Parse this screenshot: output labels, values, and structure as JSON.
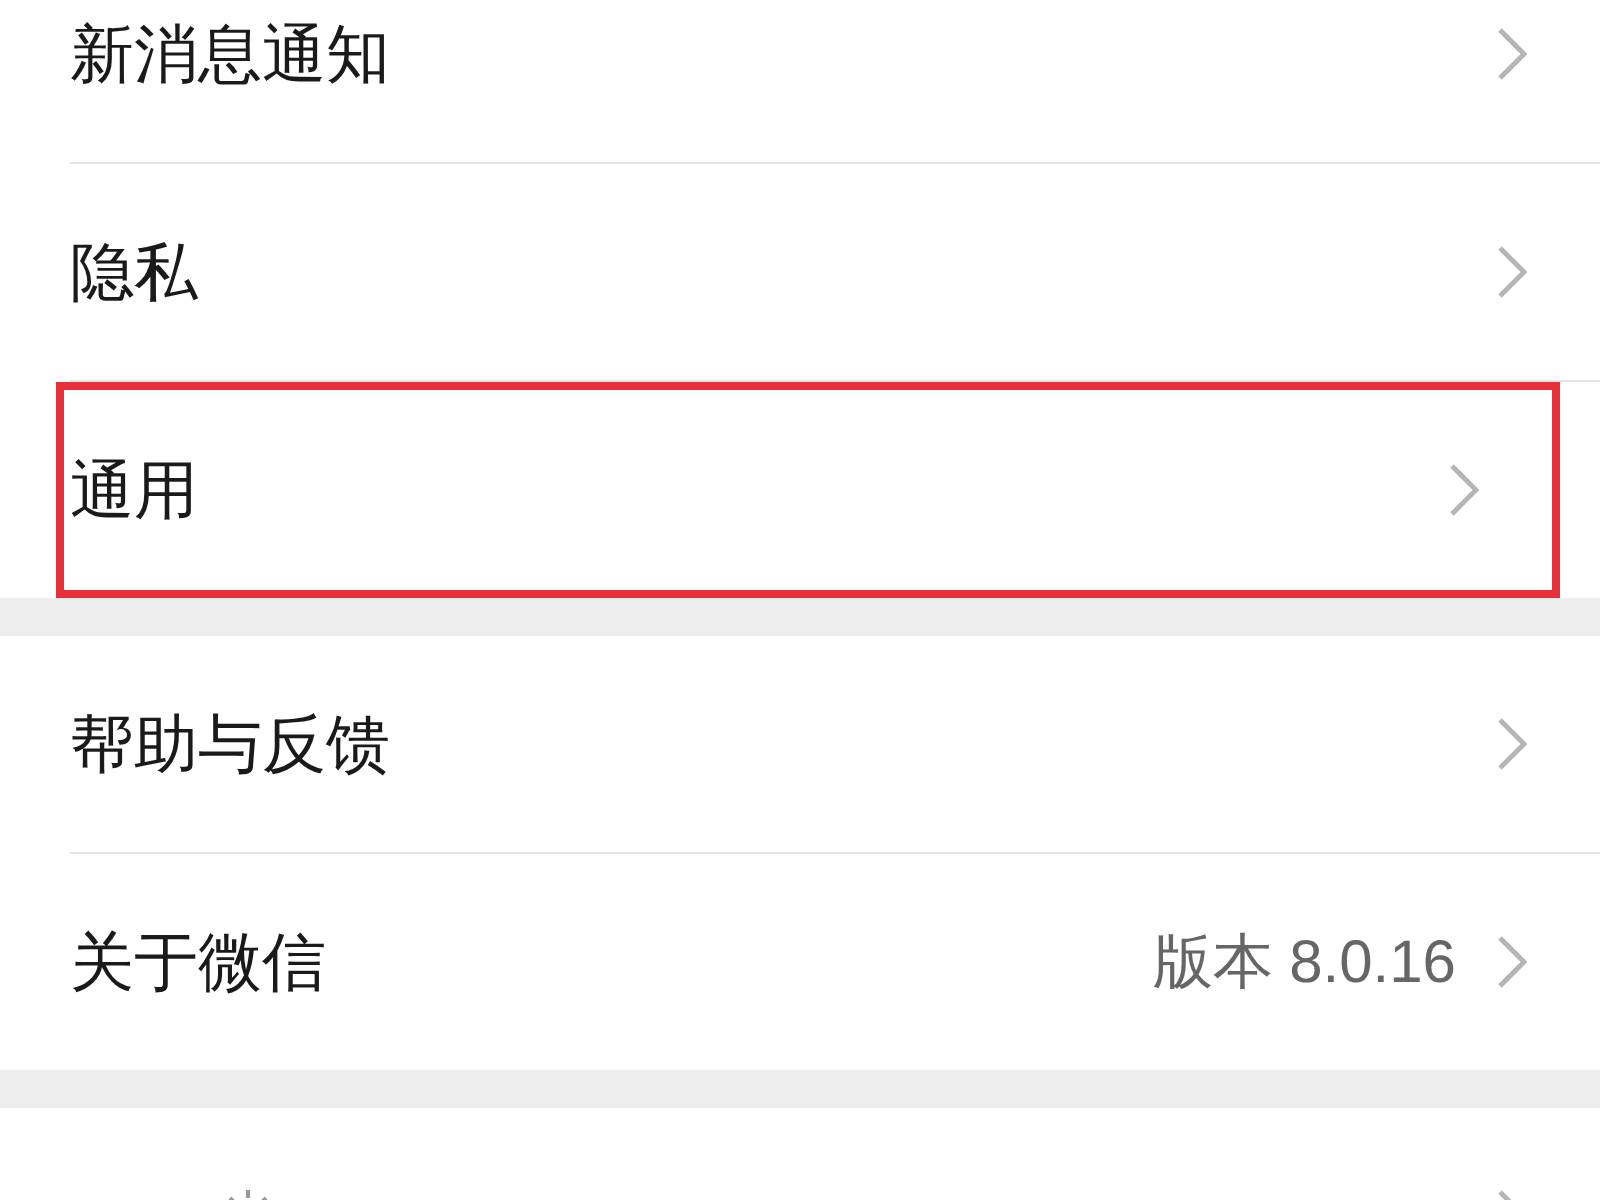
{
  "groups": [
    {
      "rows": [
        {
          "label": "新消息通知",
          "highlighted": false
        },
        {
          "label": "隐私",
          "highlighted": false
        },
        {
          "label": "通用",
          "highlighted": true
        }
      ]
    },
    {
      "rows": [
        {
          "label": "帮助与反馈",
          "highlighted": false
        },
        {
          "label": "关于微信",
          "value": "版本 8.0.16",
          "highlighted": false
        }
      ]
    },
    {
      "rows": [
        {
          "badge_icon": true,
          "highlighted": false
        }
      ]
    }
  ]
}
